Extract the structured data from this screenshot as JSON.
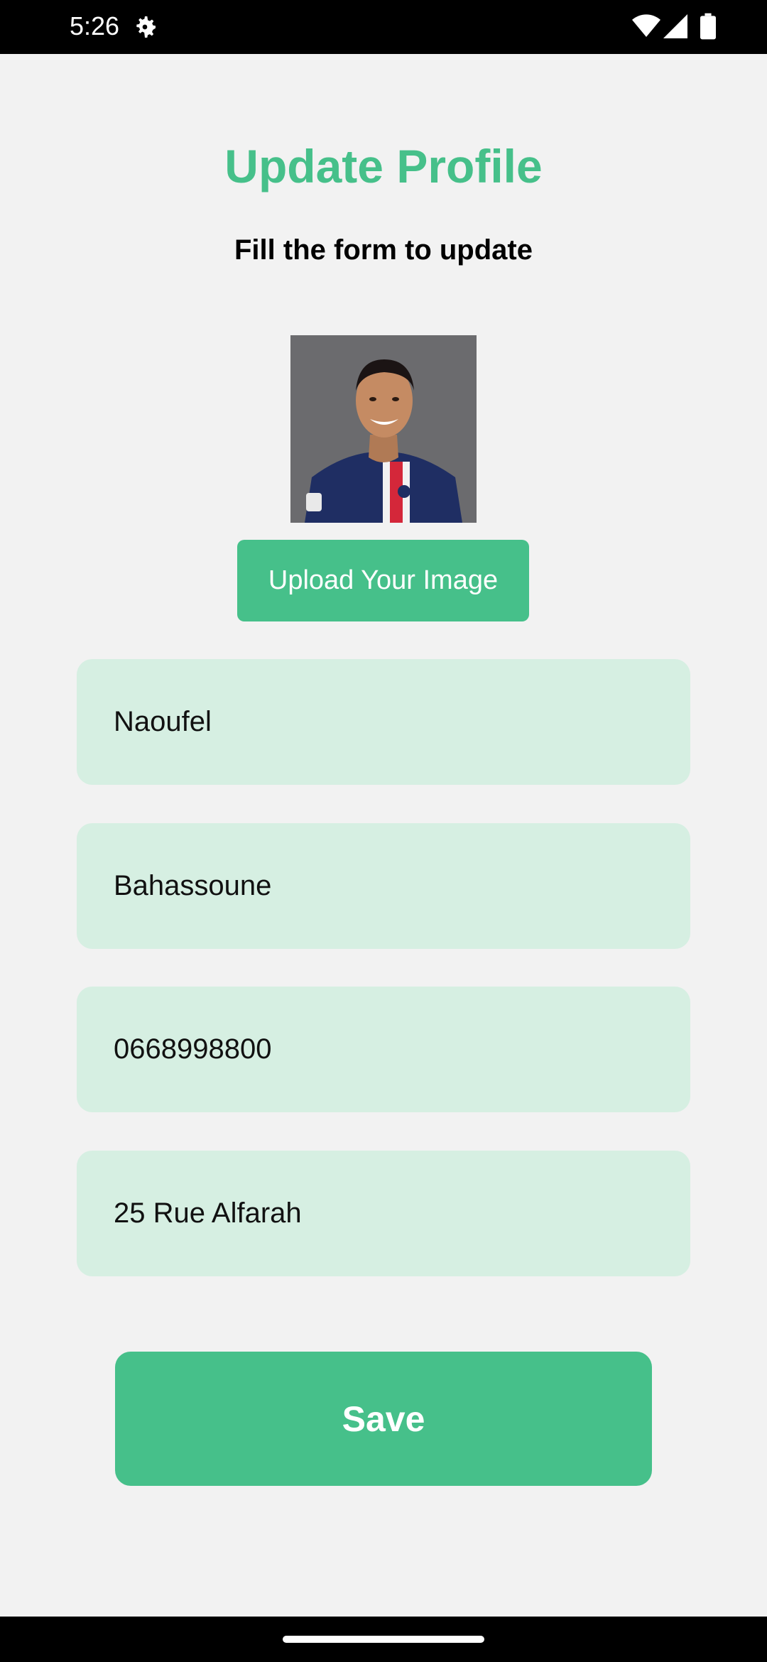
{
  "status_bar": {
    "time": "5:26",
    "icons": [
      "gear-icon",
      "wifi-icon",
      "signal-icon",
      "battery-icon"
    ]
  },
  "header": {
    "title": "Update Profile",
    "subtitle": "Fill the form to update"
  },
  "profile_image": {
    "icon": "person-photo"
  },
  "upload_button": {
    "label": "Upload Your Image"
  },
  "form": {
    "fields": [
      {
        "value": "Naoufel"
      },
      {
        "value": "Bahassoune"
      },
      {
        "value": "0668998800"
      },
      {
        "value": "25 Rue Alfarah"
      }
    ]
  },
  "save_button": {
    "label": "Save"
  },
  "colors": {
    "accent": "#46c08a",
    "field_bg": "#d6efe2",
    "background": "#f2f2f2"
  }
}
